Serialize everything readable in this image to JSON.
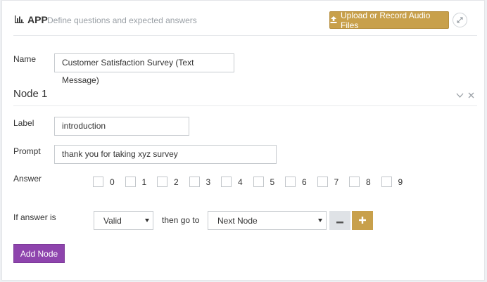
{
  "colors": {
    "accent_gold": "#c8a04b",
    "accent_purple": "#8e44ad"
  },
  "header": {
    "title": "APP",
    "subtitle": "Define questions and expected answers",
    "upload_label": "Upload or Record Audio Files",
    "icons": [
      "bar-chart-icon",
      "upload-icon",
      "expand-icon"
    ]
  },
  "form": {
    "name_label": "Name",
    "name_value": "Customer Satisfaction Survey (Text Message)"
  },
  "node": {
    "title": "Node 1",
    "label_label": "Label",
    "label_value": "introduction",
    "prompt_label": "Prompt",
    "prompt_value": "thank you for taking xyz survey",
    "answer_label": "Answer",
    "answers": [
      "0",
      "1",
      "2",
      "3",
      "4",
      "5",
      "6",
      "7",
      "8",
      "9"
    ],
    "if_label": "If answer is",
    "condition_value": "Valid",
    "goto_text": "then go to",
    "target_value": "Next Node"
  },
  "actions": {
    "add_node_label": "Add Node"
  }
}
